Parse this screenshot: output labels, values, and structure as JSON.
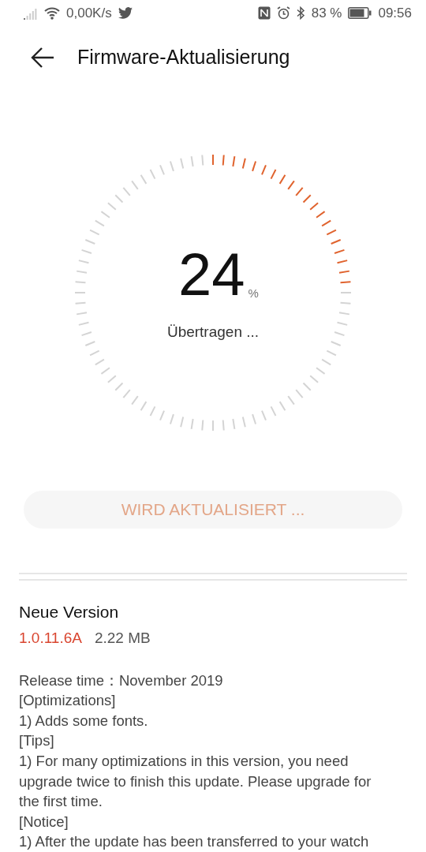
{
  "status_bar": {
    "speed": "0,00K/s",
    "battery": "83 %",
    "time": "09:56"
  },
  "header": {
    "title": "Firmware-Aktualisierung"
  },
  "progress": {
    "value": "24",
    "unit": "%",
    "status": "Übertragen ..."
  },
  "update_button": {
    "label": "WIRD AKTUALISIERT ...",
    "disabled": true
  },
  "version": {
    "heading": "Neue Version",
    "number": "1.0.11.6A",
    "size": "2.22 MB"
  },
  "release_notes": [
    "Release time：November 2019",
    "[Optimizations]",
    "1) Adds some fonts.",
    "[Tips]",
    "1) For many optimizations in this version, you need upgrade twice to finish this update. Please upgrade for the first time.",
    "[Notice]",
    "1) After the update has been transferred to your watch"
  ]
}
